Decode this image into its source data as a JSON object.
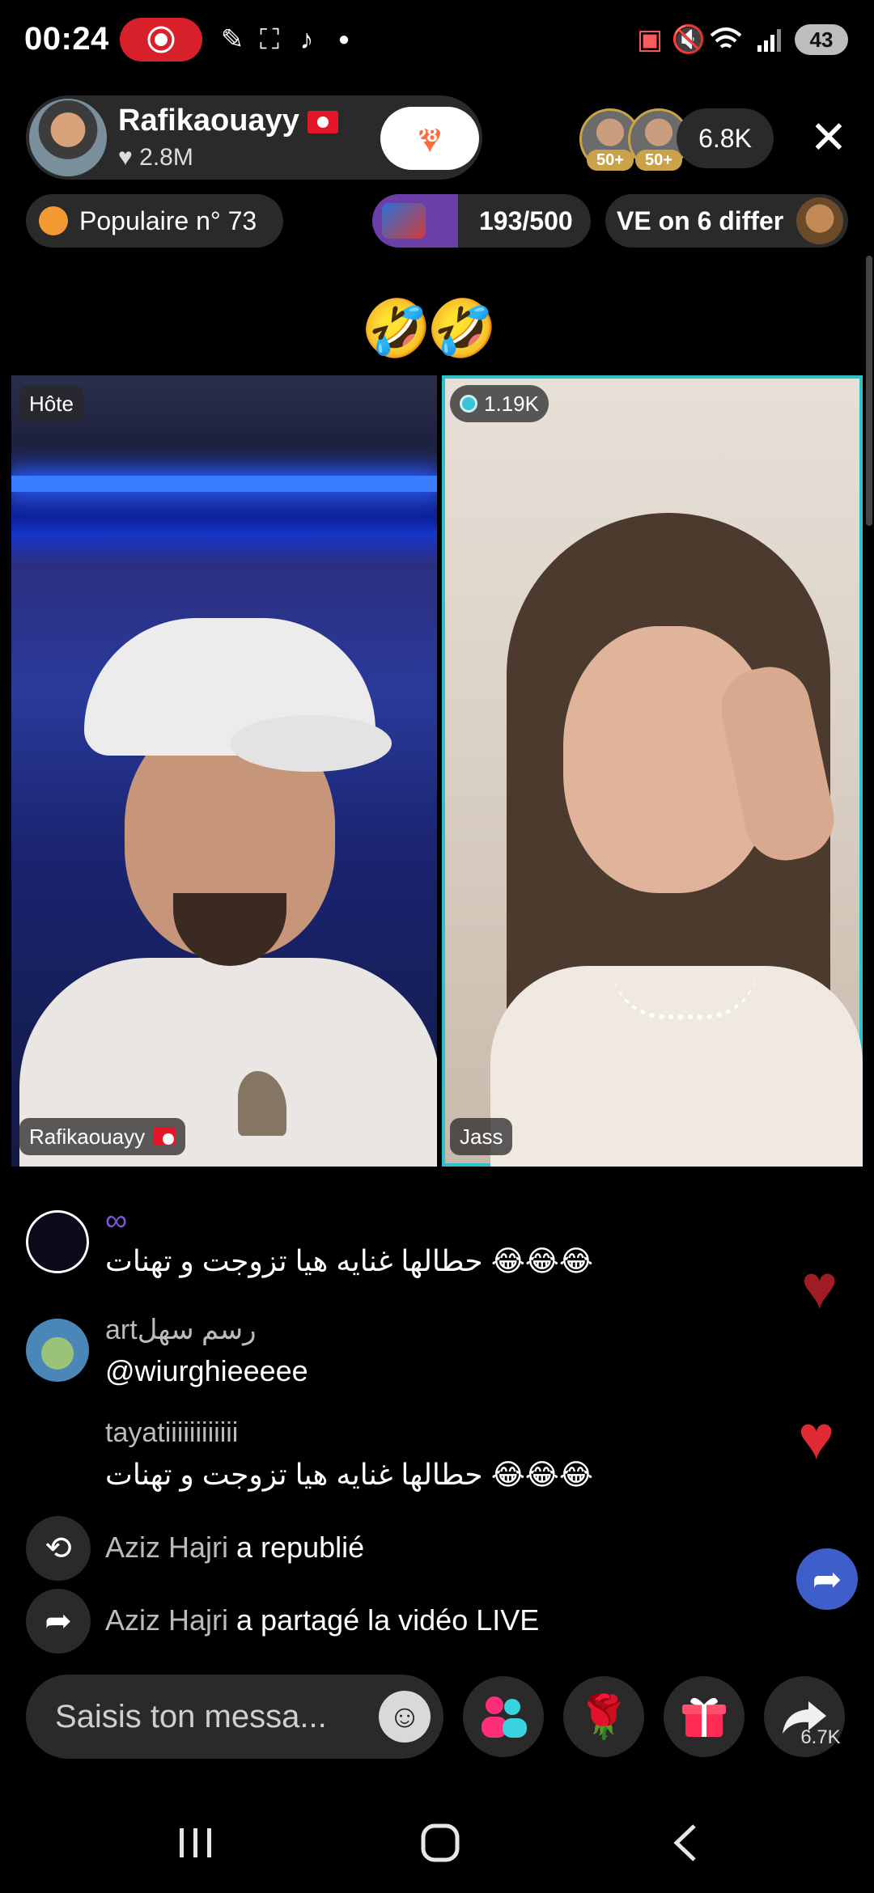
{
  "status_bar": {
    "time": "00:24",
    "battery": "43"
  },
  "host": {
    "name": "Rafikaouayy",
    "likes": "2.8M",
    "heart_count": "28"
  },
  "viewers": {
    "badge_1": "50+",
    "badge_2": "50+",
    "count": "6.8K"
  },
  "chips": {
    "popular": "Populaire n° 73",
    "goal": "193/500",
    "ve": "VE on 6 differ"
  },
  "emoji_reaction": "🤣🤣",
  "battle": {
    "host_tag": "Hôte",
    "host_name": "Rafikaouayy",
    "guest_score": "1.19K",
    "guest_name": "Jass"
  },
  "comments": [
    {
      "user": "∞",
      "text": "حطالها غنايه هيا تزوجت و تهنات 😂😂😂"
    },
    {
      "user": "artرسم سهل",
      "text": "@wiurghieeeee"
    },
    {
      "user": "tayatiiiiiiiiiiii",
      "text": "حطالها غنايه هيا تزوجت و تهنات 😂😂😂"
    }
  ],
  "system_messages": [
    {
      "user": "Aziz Hajri",
      "action": " a republié"
    },
    {
      "user": "Aziz Hajri",
      "action": " a partagé la vidéo LIVE"
    }
  ],
  "input": {
    "placeholder": "Saisis ton messa..."
  },
  "share_count": "6.7K",
  "icons": {
    "rec": "screen-record-icon",
    "close": "close-icon",
    "share": "share-arrow-icon",
    "gift": "gift-icon",
    "rose": "rose-icon",
    "multiguest": "multi-guest-icon",
    "emoji": "emoji-icon",
    "repost": "repost-icon"
  },
  "colors": {
    "accent_red": "#d8202a",
    "goal_purple": "#6b3fa8",
    "guest_border": "#2bc2c8",
    "share_blue": "#3e5ec9"
  }
}
